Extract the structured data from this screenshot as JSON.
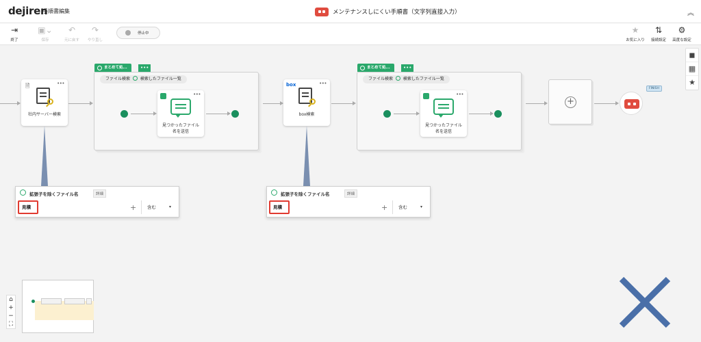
{
  "header": {
    "logo": "dejiren",
    "app_name": "手順書編集",
    "document_title": "メンテナンスしにくい手順書（文字列直接入力）",
    "collapse_icon": "chevron-double-up-icon"
  },
  "toolbar": {
    "exit_label": "終了",
    "save_label": "保存",
    "undo_label": "元に戻す",
    "redo_label": "やり直し",
    "status_label": "停止中",
    "favorite_label": "お気に入り",
    "connection_label": "接続設定",
    "advanced_label": "高度な設定"
  },
  "flow": {
    "node1_label": "社内サーバー検索",
    "group1_tag": "まとめて処...",
    "group1_chip_a": "ファイル検索",
    "group1_chip_b": "検索したファイル一覧",
    "group1_inner_label_1": "見つかったファイル",
    "group1_inner_label_2": "名を送信",
    "node2_brand": "box",
    "node2_label": "box検索",
    "group2_tag": "まとめて処...",
    "group2_chip_a": "ファイル検索",
    "group2_chip_b": "検索したファイル一覧",
    "group2_inner_label_1": "見つかったファイル",
    "group2_inner_label_2": "名を送信",
    "finish_tag": "FINISH"
  },
  "filters": [
    {
      "title": "拡張子を除くファイル名",
      "detail": "詳細",
      "value": "見積",
      "condition": "含む"
    },
    {
      "title": "拡張子を除くファイル名",
      "detail": "詳細",
      "value": "見積",
      "condition": "含む"
    }
  ],
  "dots": "•••",
  "colors": {
    "accent_green": "#2aa86b",
    "robot_red": "#e04c3f",
    "highlight_red": "#e03a30",
    "overlay_blue": "#4a6fa8"
  }
}
